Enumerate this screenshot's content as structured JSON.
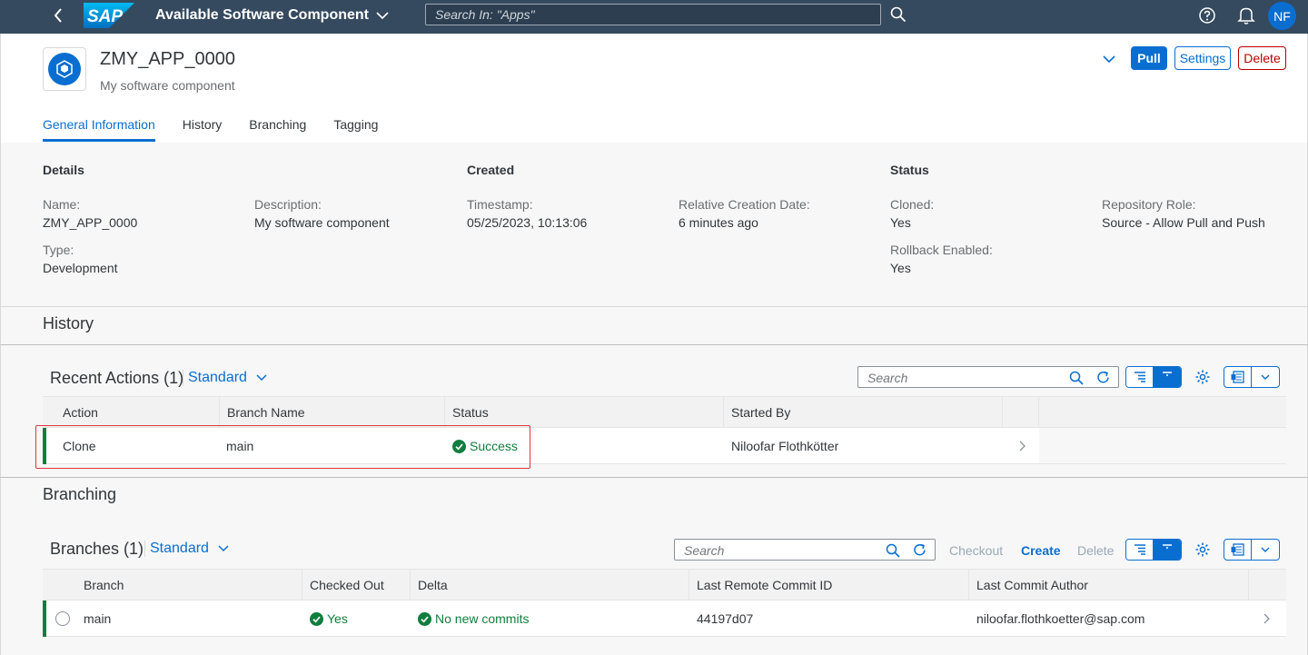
{
  "shell": {
    "app_title": "Available Software Component",
    "search_placeholder": "Search In: \"Apps\"",
    "avatar_initials": "NF",
    "logo_text": "SAP"
  },
  "header": {
    "title": "ZMY_APP_0000",
    "subtitle": "My software component",
    "pull_label": "Pull",
    "settings_label": "Settings",
    "delete_label": "Delete",
    "tabs": [
      "General Information",
      "History",
      "Branching",
      "Tagging"
    ],
    "active_tab": "General Information"
  },
  "general": {
    "details_title": "Details",
    "created_title": "Created",
    "status_title": "Status",
    "name_label": "Name:",
    "name_value": "ZMY_APP_0000",
    "description_label": "Description:",
    "description_value": "My software component",
    "type_label": "Type:",
    "type_value": "Development",
    "timestamp_label": "Timestamp:",
    "timestamp_value": "05/25/2023, 10:13:06",
    "relative_label": "Relative Creation Date:",
    "relative_value": "6 minutes ago",
    "cloned_label": "Cloned:",
    "cloned_value": "Yes",
    "role_label": "Repository Role:",
    "role_value": "Source - Allow Pull and Push",
    "rollback_label": "Rollback Enabled:",
    "rollback_value": "Yes"
  },
  "history": {
    "section_title": "History",
    "table_title": "Recent Actions (1)",
    "variant": "Standard",
    "search_placeholder": "Search",
    "columns": [
      "Action",
      "Branch Name",
      "Status",
      "Started By"
    ],
    "rows": [
      {
        "action": "Clone",
        "branch": "main",
        "status": "Success",
        "started_by": "Niloofar Flothkötter"
      }
    ]
  },
  "branching": {
    "section_title": "Branching",
    "table_title": "Branches (1)",
    "variant": "Standard",
    "search_placeholder": "Search",
    "checkout_label": "Checkout",
    "create_label": "Create",
    "delete_label": "Delete",
    "columns": [
      "Branch",
      "Checked Out",
      "Delta",
      "Last Remote Commit ID",
      "Last Commit Author"
    ],
    "rows": [
      {
        "branch": "main",
        "checked_out": "Yes",
        "delta": "No new commits",
        "commit_id": "44197d07",
        "author": "niloofar.flothkoetter@sap.com"
      }
    ]
  },
  "colors": {
    "shell": "#354a5f",
    "accent": "#0a6ed1",
    "success": "#107e3e",
    "danger": "#bb0000",
    "highlight": "#d9383a"
  }
}
